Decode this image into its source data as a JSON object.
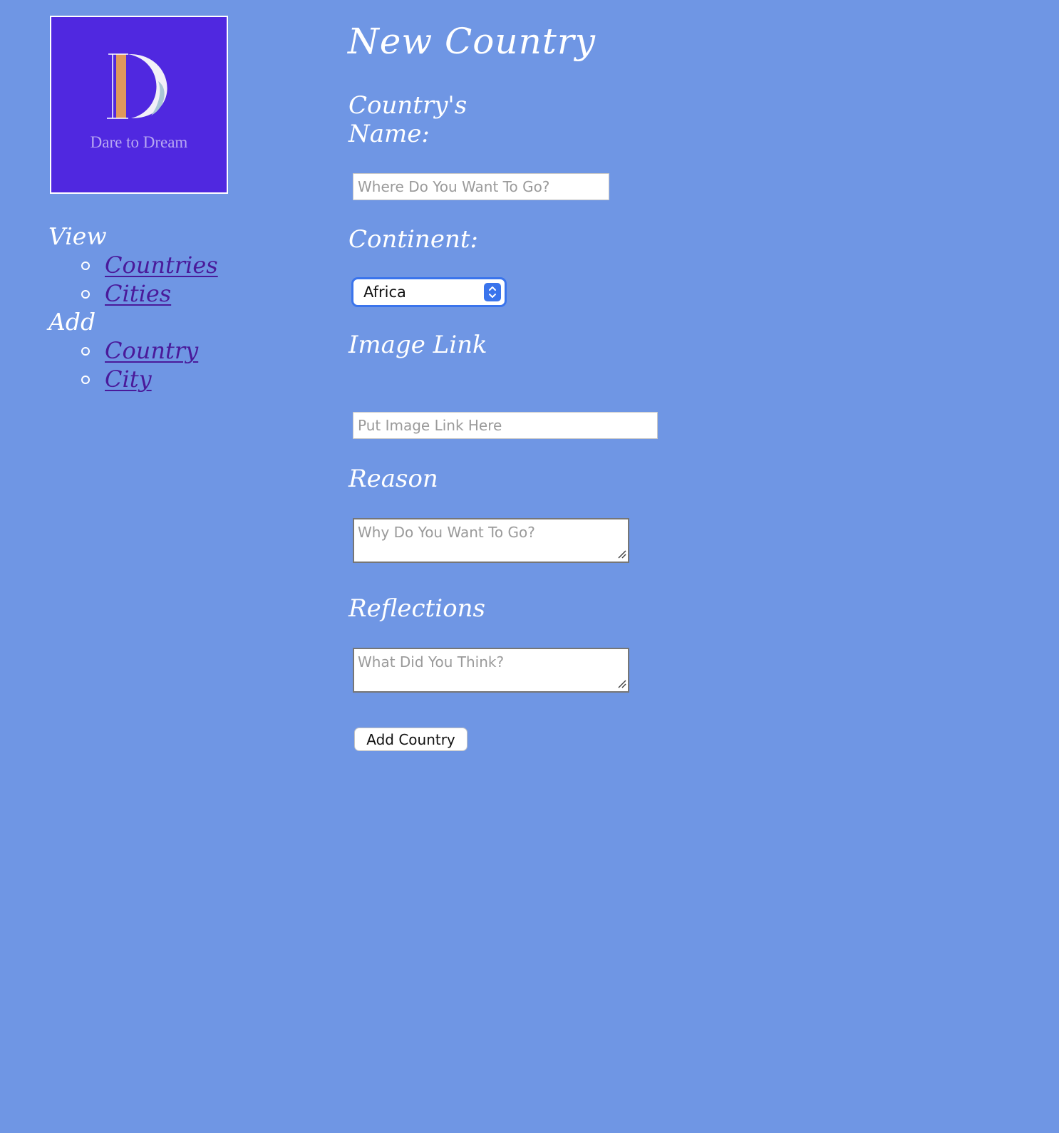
{
  "logo": {
    "letter": "D",
    "tagline": "Dare to Dream",
    "colors": {
      "background": "#5028e0",
      "accent": "#e0985c"
    }
  },
  "nav": {
    "sections": [
      {
        "heading": "View",
        "links": [
          "Countries",
          "Cities"
        ]
      },
      {
        "heading": "Add",
        "links": [
          "Country",
          "City"
        ]
      }
    ]
  },
  "form": {
    "title": "New Country",
    "name_label": "Country's Name:",
    "name_placeholder": "Where Do You Want To Go?",
    "continent_label": "Continent:",
    "continent_selected": "Africa",
    "image_label": "Image Link",
    "image_placeholder": "Put Image Link Here",
    "reason_label": "Reason",
    "reason_placeholder": "Why Do You Want To Go?",
    "reflections_label": "Reflections",
    "reflections_placeholder": "What Did You Think?",
    "submit_label": "Add Country"
  },
  "theme": {
    "page_background": "#6f96e4",
    "link_color": "#4a1a9a",
    "select_accent": "#3a74ec"
  },
  "icons": [
    "chevron-up-down-icon",
    "resize-grip-icon"
  ]
}
